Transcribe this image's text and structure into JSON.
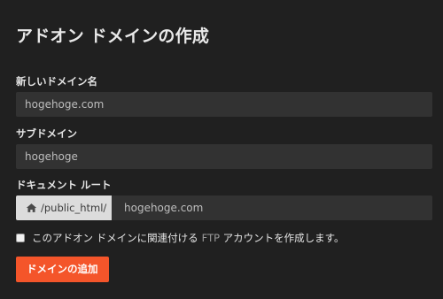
{
  "page": {
    "title": "アドオン ドメインの作成"
  },
  "form": {
    "new_domain": {
      "label": "新しいドメイン名",
      "value": "hogehoge.com"
    },
    "subdomain": {
      "label": "サブドメイン",
      "value": "hogehoge"
    },
    "document_root": {
      "label": "ドキュメント ルート",
      "prefix": "/public_html/",
      "prefix_icon": "home-icon",
      "value": "hogehoge.com"
    },
    "ftp_checkbox": {
      "checked": false,
      "text_before": "このアドオン ドメインに関連付ける",
      "text_ftp": "FTP",
      "text_after": " アカウントを作成します。"
    },
    "submit_label": "ドメインの追加"
  },
  "colors": {
    "background": "#202020",
    "input_background": "#323232",
    "accent": "#f4552a"
  }
}
